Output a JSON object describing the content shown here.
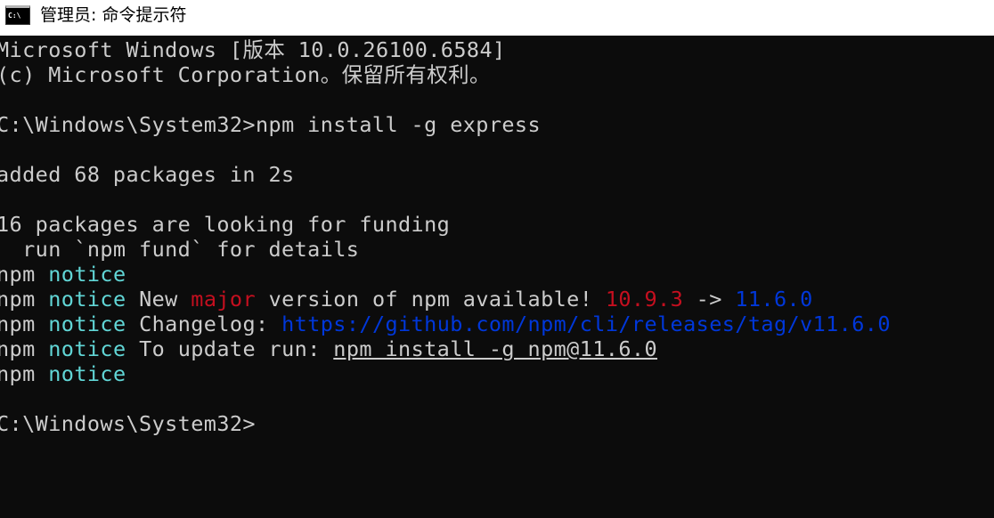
{
  "window": {
    "title": "管理员: 命令提示符",
    "icon_label": "C:\\"
  },
  "console": {
    "banner_line1": "Microsoft Windows [版本 10.0.26100.6584]",
    "banner_line2": "(c) Microsoft Corporation。保留所有权利。",
    "prompt": "C:\\Windows\\System32>",
    "command": "npm install -g express",
    "added": "added 68 packages in 2s",
    "funding_line1": "16 packages are looking for funding",
    "funding_line2": "  run `npm fund` for details",
    "npm_prefix": "npm",
    "notice_word": "notice",
    "notice2_pre": " New ",
    "notice2_major": "major",
    "notice2_mid": " version of npm available! ",
    "notice2_old": "10.9.3",
    "notice2_arrow": " -> ",
    "notice2_new": "11.6.0",
    "notice3_label": " Changelog: ",
    "notice3_url": "https://github.com/npm/cli/releases/tag/v11.6.0",
    "notice4_label": " To update run: ",
    "notice4_cmd": "npm install -g npm@11.6.0",
    "final_prompt": "C:\\Windows\\System32>"
  },
  "colors": {
    "background": "#0c0c0c",
    "text": "#cccccc",
    "notice": "#61d6d6",
    "major": "#c50f1f",
    "new_version": "#0037da"
  }
}
